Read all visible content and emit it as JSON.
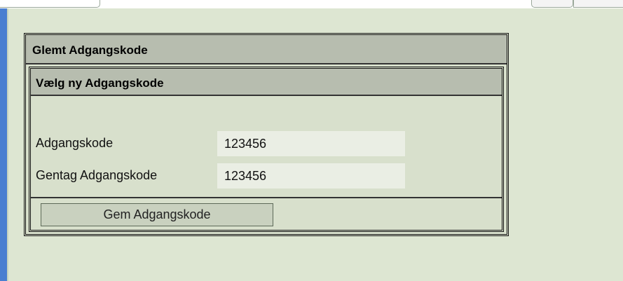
{
  "window": {},
  "panel": {
    "title": "Glemt Adgangskode"
  },
  "subpanel": {
    "title": "Vælg ny Adgangskode"
  },
  "form": {
    "password_label": "Adgangskode",
    "password_value": "123456",
    "repeat_label": "Gentag Adgangskode",
    "repeat_value": "123456",
    "save_label": "Gem Adgangskode"
  },
  "colors": {
    "background": "#dde6d2",
    "header": "#b7bdaf",
    "input_bg": "#eaeee4",
    "border": "#111111",
    "left_edge": "#4a7fd1"
  }
}
